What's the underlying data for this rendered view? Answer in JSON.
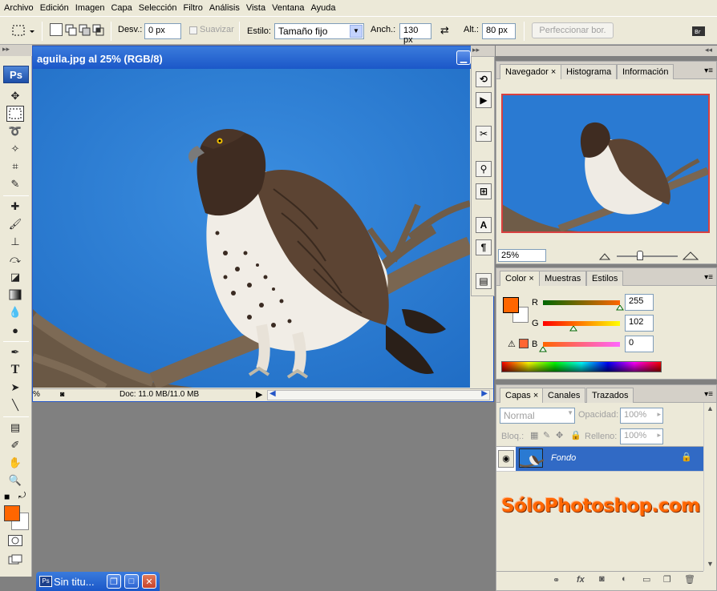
{
  "menu": [
    "Archivo",
    "Edición",
    "Imagen",
    "Capa",
    "Selección",
    "Filtro",
    "Análisis",
    "Vista",
    "Ventana",
    "Ayuda"
  ],
  "options": {
    "desv_label": "Desv.:",
    "desv_value": "0 px",
    "suavizar_label": "Suavizar",
    "estilo_label": "Estilo:",
    "estilo_value": "Tamaño fijo",
    "anch_label": "Anch.:",
    "anch_value": "130 px",
    "alt_label": "Alt.:",
    "alt_value": "80 px",
    "refine_label": "Perfeccionar bor."
  },
  "toolbox": {
    "logo": "Ps"
  },
  "document": {
    "title": "aguila.jpg al 25% (RGB/8)",
    "zoom_status": "%",
    "doc_info": "Doc: 11.0 MB/11.0 MB"
  },
  "navigator": {
    "tabs": [
      "Navegador",
      "Histograma",
      "Información"
    ],
    "zoom": "25%"
  },
  "color": {
    "tabs": [
      "Color",
      "Muestras",
      "Estilos"
    ],
    "r_label": "R",
    "r_value": "255",
    "g_label": "G",
    "g_value": "102",
    "b_label": "B",
    "b_value": "0",
    "r_level": 1.0,
    "g_level": 0.4,
    "b_level": 0.0,
    "foreground": "#ff6600"
  },
  "layers": {
    "tabs": [
      "Capas",
      "Canales",
      "Trazados"
    ],
    "blend_mode": "Normal",
    "opacity_label": "Opacidad:",
    "opacity_value": "100%",
    "lock_label": "Bloq.:",
    "fill_label": "Relleno:",
    "fill_value": "100%",
    "layer_name": "Fondo"
  },
  "watermark": "SóloPhotoshop.com",
  "minimized": {
    "title": "Sin titu..."
  }
}
